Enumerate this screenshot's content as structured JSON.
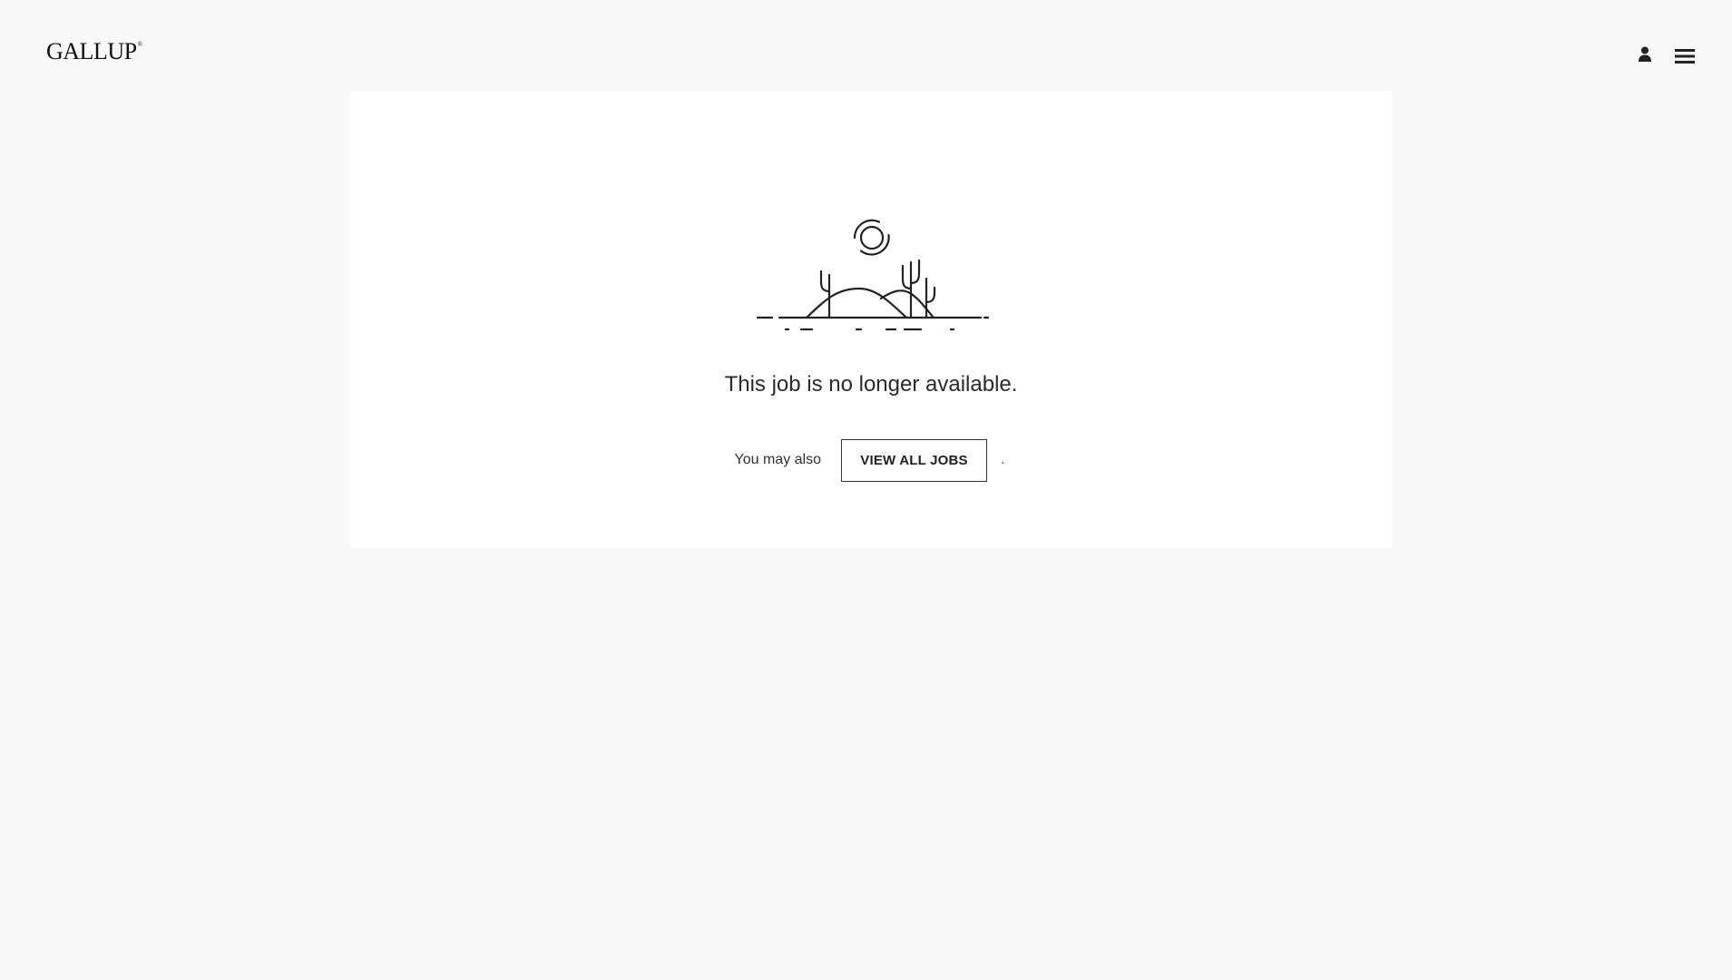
{
  "header": {
    "logo_text": "GALLUP",
    "logo_mark": "®",
    "icons": [
      "user-icon",
      "hamburger-menu-icon"
    ]
  },
  "main": {
    "illustration": "desert-landscape-icon",
    "message": "This job is no longer available.",
    "suggestion_text": "You may also",
    "view_all_label": "VIEW ALL JOBS",
    "trailing_punctuation": "."
  },
  "colors": {
    "background": "#f8f8f8",
    "card": "#ffffff",
    "text": "#222222"
  }
}
